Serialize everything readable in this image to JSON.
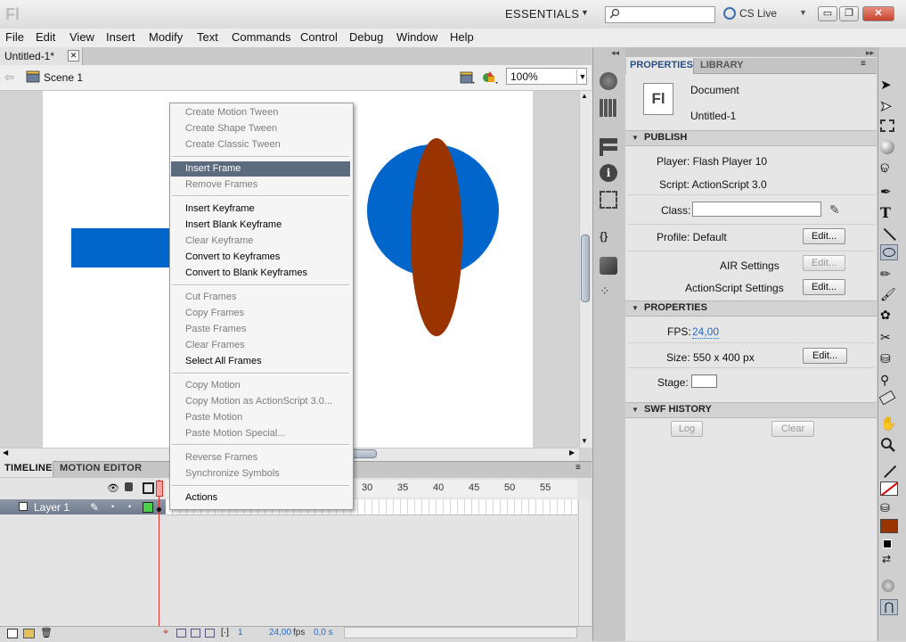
{
  "titlebar": {
    "app_logo": "Fl",
    "workspace": "ESSENTIALS",
    "cslive": "CS Live",
    "min": "▭",
    "restore": "❐",
    "close": "✕"
  },
  "menu": [
    "File",
    "Edit",
    "View",
    "Insert",
    "Modify",
    "Text",
    "Commands",
    "Control",
    "Debug",
    "Window",
    "Help"
  ],
  "document_tab": {
    "label": "Untitled-1*",
    "close": "✕"
  },
  "editbar": {
    "scene": "Scene 1",
    "zoom": "100%"
  },
  "colors": {
    "rect": "#0066cc",
    "circle": "#0066cc",
    "ellipse": "#993300",
    "highlight": "#5c6b7e",
    "fill_swatch": "#993300"
  },
  "context_menu": {
    "items": [
      {
        "label": "Create Motion Tween",
        "enabled": false
      },
      {
        "label": "Create Shape Tween",
        "enabled": false
      },
      {
        "label": "Create Classic Tween",
        "enabled": false
      },
      {
        "label": "Insert Frame",
        "enabled": true,
        "highlighted": true
      },
      {
        "label": "Remove Frames",
        "enabled": false
      },
      {
        "label": "Insert Keyframe",
        "enabled": true
      },
      {
        "label": "Insert Blank Keyframe",
        "enabled": true
      },
      {
        "label": "Clear Keyframe",
        "enabled": false
      },
      {
        "label": "Convert to Keyframes",
        "enabled": true
      },
      {
        "label": "Convert to Blank Keyframes",
        "enabled": true
      },
      {
        "label": "Cut Frames",
        "enabled": false
      },
      {
        "label": "Copy Frames",
        "enabled": false
      },
      {
        "label": "Paste Frames",
        "enabled": false
      },
      {
        "label": "Clear Frames",
        "enabled": false
      },
      {
        "label": "Select All Frames",
        "enabled": true
      },
      {
        "label": "Copy Motion",
        "enabled": false
      },
      {
        "label": "Copy Motion as ActionScript 3.0...",
        "enabled": false
      },
      {
        "label": "Paste Motion",
        "enabled": false
      },
      {
        "label": "Paste Motion Special...",
        "enabled": false
      },
      {
        "label": "Reverse Frames",
        "enabled": false
      },
      {
        "label": "Synchronize Symbols",
        "enabled": false
      },
      {
        "label": "Actions",
        "enabled": true
      }
    ]
  },
  "timeline": {
    "tabs": [
      "TIMELINE",
      "MOTION EDITOR"
    ],
    "ticks": [
      "30",
      "35",
      "40",
      "45",
      "50",
      "55"
    ],
    "layer": "Layer 1",
    "status": {
      "frame": "1",
      "fps": "24,00",
      "fps_unit": "fps",
      "time": "0,0 s"
    }
  },
  "properties": {
    "tabs": [
      "PROPERTIES",
      "LIBRARY"
    ],
    "doc_icon": "Fl",
    "doc_type": "Document",
    "doc_name": "Untitled-1",
    "publish": {
      "header": "PUBLISH",
      "player": "Player: Flash Player 10",
      "script": "Script: ActionScript 3.0",
      "class_label": "Class:",
      "profile": "Profile: Default",
      "edit": "Edit...",
      "air": "AIR Settings",
      "air_edit": "Edit...",
      "as_settings": "ActionScript Settings",
      "as_edit": "Edit..."
    },
    "props": {
      "header": "PROPERTIES",
      "fps_label": "FPS:",
      "fps": "24,00",
      "size": "Size: 550 x 400 px",
      "size_edit": "Edit...",
      "stage_label": "Stage:"
    },
    "swf": {
      "header": "SWF HISTORY",
      "log": "Log",
      "clear": "Clear"
    }
  }
}
